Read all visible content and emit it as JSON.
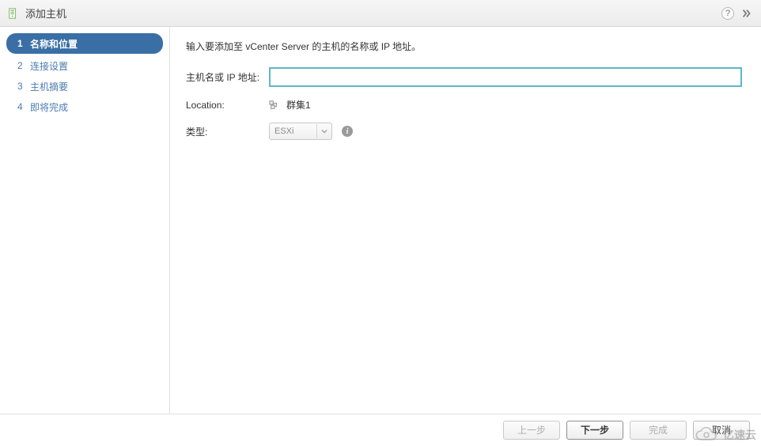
{
  "titlebar": {
    "title": "添加主机",
    "help_tooltip": "?",
    "popout_glyph": "▸▸"
  },
  "sidebar": {
    "steps": [
      {
        "num": "1",
        "label": "名称和位置"
      },
      {
        "num": "2",
        "label": "连接设置"
      },
      {
        "num": "3",
        "label": "主机摘要"
      },
      {
        "num": "4",
        "label": "即将完成"
      }
    ],
    "active_index": 0
  },
  "main": {
    "instruction": "输入要添加至 vCenter Server 的主机的名称或 IP 地址。",
    "host_label": "主机名或 IP 地址:",
    "host_value": "",
    "location_label": "Location:",
    "location_value": "群集1",
    "type_label": "类型:",
    "type_value": "ESXi",
    "info_glyph": "i"
  },
  "footer": {
    "back": "上一步",
    "next": "下一步",
    "finish": "完成",
    "cancel": "取消"
  },
  "watermark": {
    "text": "亿速云"
  }
}
